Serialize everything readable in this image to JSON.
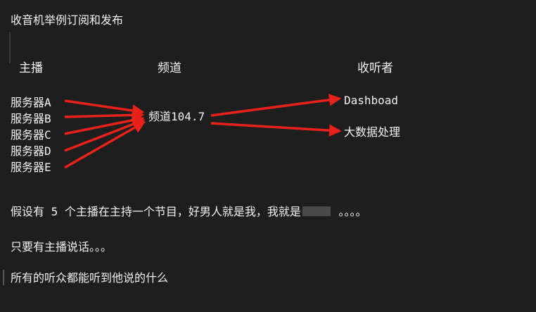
{
  "title": "收音机举例订阅和发布",
  "headers": {
    "publisher": "主播",
    "channel": "频道",
    "subscriber": "收听者"
  },
  "servers": [
    "服务器A",
    "服务器B",
    "服务器C",
    "服务器D",
    "服务器E"
  ],
  "channel_label": "频道104.7",
  "subscribers": [
    "Dashboad",
    "大数据处理"
  ],
  "paragraphs": {
    "p1_before": "假设有 5 个主播在主持一个节目，好男人就是我，我就是",
    "p1_after": " 。。。。",
    "p2": "只要有主播说话。。。",
    "p3": "所有的听众都能听到他说的什么"
  },
  "colors": {
    "background": "#1e1e1e",
    "text": "#f2f2f2",
    "arrow": "#e8221b",
    "redaction": "#4a4a4a"
  }
}
